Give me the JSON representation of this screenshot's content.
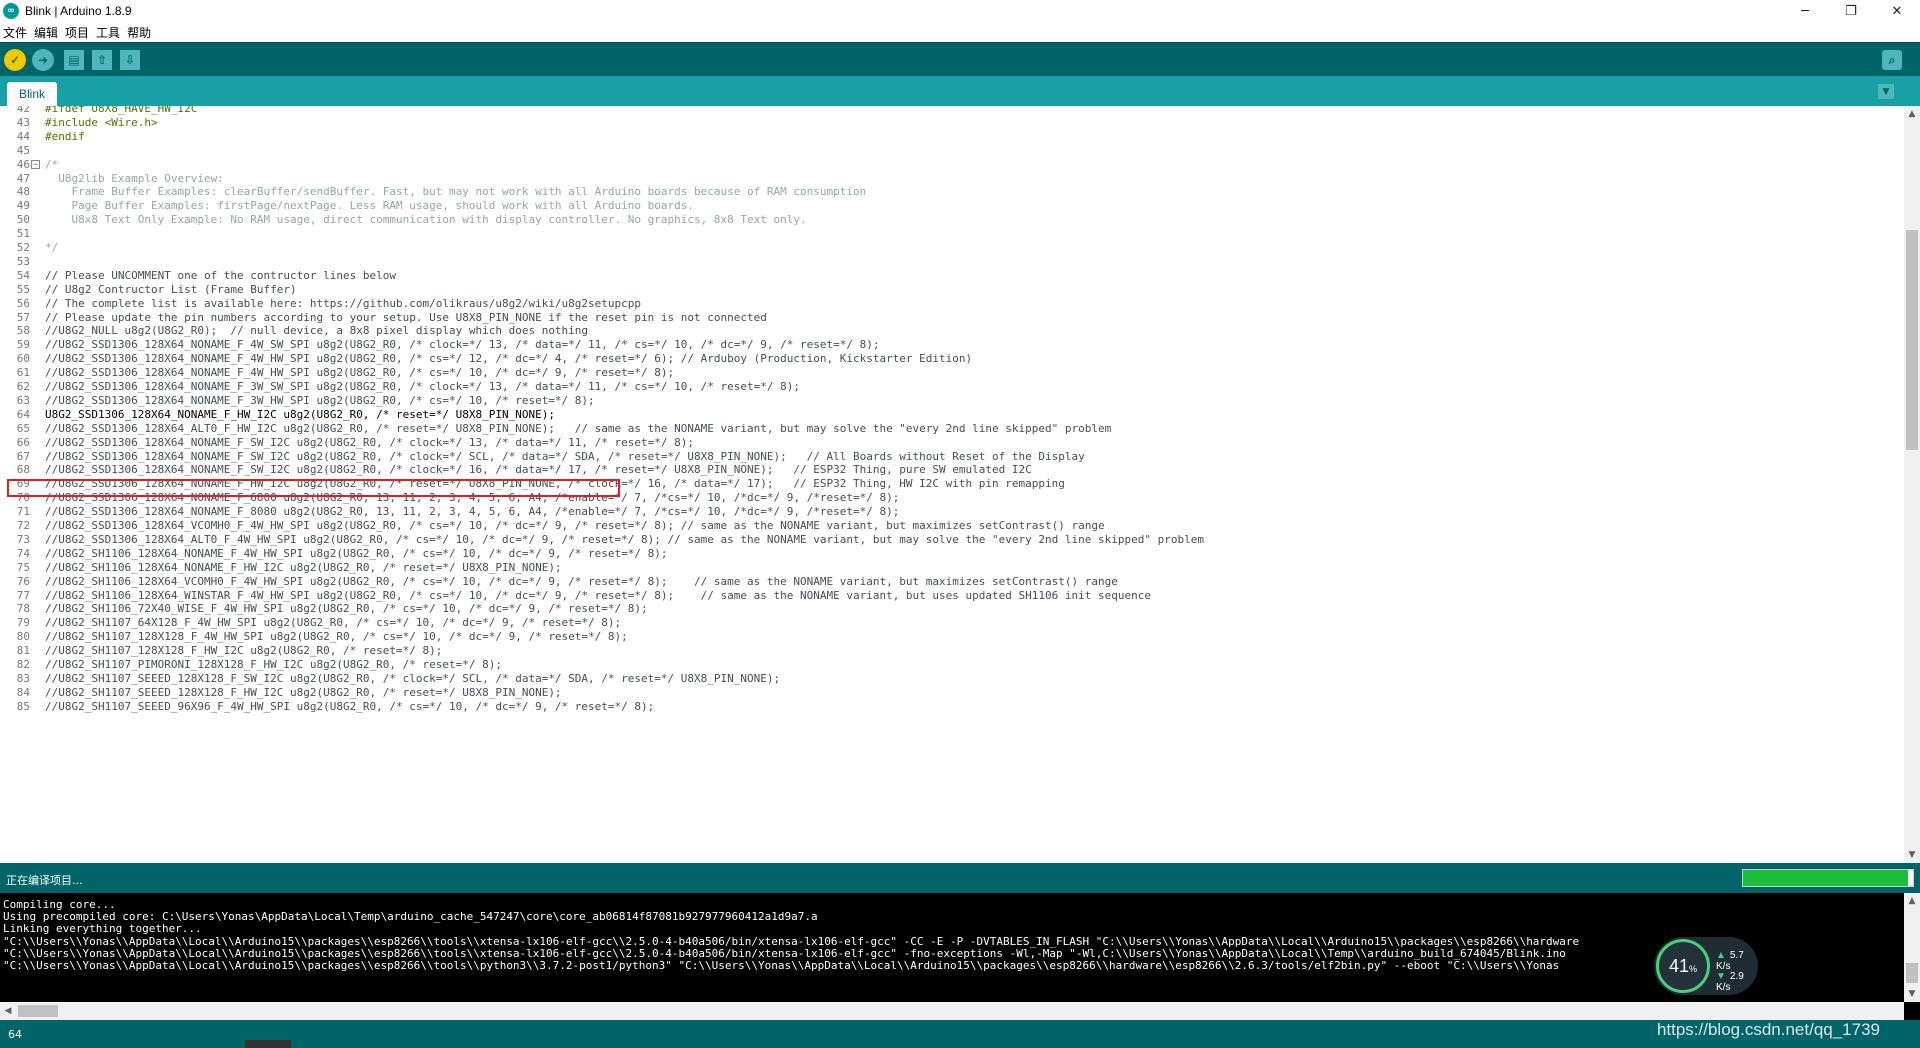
{
  "window": {
    "title": "Blink | Arduino 1.8.9",
    "icon_glyph": "∞",
    "minimize_glyph": "─",
    "maximize_glyph": "❐",
    "close_glyph": "✕"
  },
  "menu": [
    "文件",
    "编辑",
    "项目",
    "工具",
    "帮助"
  ],
  "toolbar": {
    "verify_icon": "check-icon",
    "upload_icon": "arrow-right-icon",
    "new_icon": "new-file-icon",
    "open_icon": "upload-arrow-icon",
    "save_icon": "download-arrow-icon",
    "monitor_icon": "serial-monitor-icon",
    "verify_glyph": "✓",
    "upload_glyph": "➜",
    "new_glyph": "▤",
    "open_glyph": "⇧",
    "save_glyph": "⇩",
    "monitor_glyph": "⌕"
  },
  "tabs": [
    {
      "label": "Blink"
    }
  ],
  "tab_menu_glyph": "▼",
  "editor": {
    "lines": [
      {
        "n": "42",
        "text": "#ifdef U8X8_HAVE_HW_I2C",
        "kind": "dir"
      },
      {
        "n": "43",
        "text": "#include <Wire.h>",
        "kind": "dir"
      },
      {
        "n": "44",
        "text": "#endif",
        "kind": "dir"
      },
      {
        "n": "45",
        "text": "",
        "kind": "code"
      },
      {
        "n": "46",
        "text": "/*",
        "kind": "cmt",
        "fold": true
      },
      {
        "n": "47",
        "text": "  U8g2lib Example Overview:",
        "kind": "cmt"
      },
      {
        "n": "48",
        "text": "    Frame Buffer Examples: clearBuffer/sendBuffer. Fast, but may not work with all Arduino boards because of RAM consumption",
        "kind": "cmt"
      },
      {
        "n": "49",
        "text": "    Page Buffer Examples: firstPage/nextPage. Less RAM usage, should work with all Arduino boards.",
        "kind": "cmt"
      },
      {
        "n": "50",
        "text": "    U8x8 Text Only Example: No RAM usage, direct communication with display controller. No graphics, 8x8 Text only.",
        "kind": "cmt"
      },
      {
        "n": "51",
        "text": "",
        "kind": "cmt"
      },
      {
        "n": "52",
        "text": "*/",
        "kind": "cmt"
      },
      {
        "n": "53",
        "text": "",
        "kind": "code"
      },
      {
        "n": "54",
        "text": "// Please UNCOMMENT one of the contructor lines below",
        "kind": "code"
      },
      {
        "n": "55",
        "text": "// U8g2 Contructor List (Frame Buffer)",
        "kind": "code"
      },
      {
        "n": "56",
        "text": "// The complete list is available here: https://github.com/olikraus/u8g2/wiki/u8g2setupcpp",
        "kind": "code"
      },
      {
        "n": "57",
        "text": "// Please update the pin numbers according to your setup. Use U8X8_PIN_NONE if the reset pin is not connected",
        "kind": "code"
      },
      {
        "n": "58",
        "text": "//U8G2_NULL u8g2(U8G2_R0);  // null device, a 8x8 pixel display which does nothing",
        "kind": "code"
      },
      {
        "n": "59",
        "text": "//U8G2_SSD1306_128X64_NONAME_F_4W_SW_SPI u8g2(U8G2_R0, /* clock=*/ 13, /* data=*/ 11, /* cs=*/ 10, /* dc=*/ 9, /* reset=*/ 8);",
        "kind": "code"
      },
      {
        "n": "60",
        "text": "//U8G2_SSD1306_128X64_NONAME_F_4W_HW_SPI u8g2(U8G2_R0, /* cs=*/ 12, /* dc=*/ 4, /* reset=*/ 6); // Arduboy (Production, Kickstarter Edition)",
        "kind": "code"
      },
      {
        "n": "61",
        "text": "//U8G2_SSD1306_128X64_NONAME_F_4W_HW_SPI u8g2(U8G2_R0, /* cs=*/ 10, /* dc=*/ 9, /* reset=*/ 8);",
        "kind": "code"
      },
      {
        "n": "62",
        "text": "//U8G2_SSD1306_128X64_NONAME_F_3W_SW_SPI u8g2(U8G2_R0, /* clock=*/ 13, /* data=*/ 11, /* cs=*/ 10, /* reset=*/ 8);",
        "kind": "code"
      },
      {
        "n": "63",
        "text": "//U8G2_SSD1306_128X64_NONAME_F_3W_HW_SPI u8g2(U8G2_R0, /* cs=*/ 10, /* reset=*/ 8);",
        "kind": "code"
      },
      {
        "n": "64",
        "text": "U8G2_SSD1306_128X64_NONAME_F_HW_I2C u8g2(U8G2_R0, /* reset=*/ U8X8_PIN_NONE);",
        "kind": "code",
        "highlight": true
      },
      {
        "n": "65",
        "text": "//U8G2_SSD1306_128X64_ALT0_F_HW_I2C u8g2(U8G2_R0, /* reset=*/ U8X8_PIN_NONE);   // same as the NONAME variant, but may solve the \"every 2nd line skipped\" problem",
        "kind": "code"
      },
      {
        "n": "66",
        "text": "//U8G2_SSD1306_128X64_NONAME_F_SW_I2C u8g2(U8G2_R0, /* clock=*/ 13, /* data=*/ 11, /* reset=*/ 8);",
        "kind": "code"
      },
      {
        "n": "67",
        "text": "//U8G2_SSD1306_128X64_NONAME_F_SW_I2C u8g2(U8G2_R0, /* clock=*/ SCL, /* data=*/ SDA, /* reset=*/ U8X8_PIN_NONE);   // All Boards without Reset of the Display",
        "kind": "code"
      },
      {
        "n": "68",
        "text": "//U8G2_SSD1306_128X64_NONAME_F_SW_I2C u8g2(U8G2_R0, /* clock=*/ 16, /* data=*/ 17, /* reset=*/ U8X8_PIN_NONE);   // ESP32 Thing, pure SW emulated I2C",
        "kind": "code"
      },
      {
        "n": "69",
        "text": "//U8G2_SSD1306_128X64_NONAME_F_HW_I2C u8g2(U8G2_R0, /* reset=*/ U8X8_PIN_NONE, /* clock=*/ 16, /* data=*/ 17);   // ESP32 Thing, HW I2C with pin remapping",
        "kind": "code"
      },
      {
        "n": "70",
        "text": "//U8G2_SSD1306_128X64_NONAME_F_6800 u8g2(U8G2_R0, 13, 11, 2, 3, 4, 5, 6, A4, /*enable=*/ 7, /*cs=*/ 10, /*dc=*/ 9, /*reset=*/ 8);",
        "kind": "code"
      },
      {
        "n": "71",
        "text": "//U8G2_SSD1306_128X64_NONAME_F_8080 u8g2(U8G2_R0, 13, 11, 2, 3, 4, 5, 6, A4, /*enable=*/ 7, /*cs=*/ 10, /*dc=*/ 9, /*reset=*/ 8);",
        "kind": "code"
      },
      {
        "n": "72",
        "text": "//U8G2_SSD1306_128X64_VCOMH0_F_4W_HW_SPI u8g2(U8G2_R0, /* cs=*/ 10, /* dc=*/ 9, /* reset=*/ 8); // same as the NONAME variant, but maximizes setContrast() range",
        "kind": "code"
      },
      {
        "n": "73",
        "text": "//U8G2_SSD1306_128X64_ALT0_F_4W_HW_SPI u8g2(U8G2_R0, /* cs=*/ 10, /* dc=*/ 9, /* reset=*/ 8); // same as the NONAME variant, but may solve the \"every 2nd line skipped\" problem",
        "kind": "code"
      },
      {
        "n": "74",
        "text": "//U8G2_SH1106_128X64_NONAME_F_4W_HW_SPI u8g2(U8G2_R0, /* cs=*/ 10, /* dc=*/ 9, /* reset=*/ 8);",
        "kind": "code"
      },
      {
        "n": "75",
        "text": "//U8G2_SH1106_128X64_NONAME_F_HW_I2C u8g2(U8G2_R0, /* reset=*/ U8X8_PIN_NONE);",
        "kind": "code"
      },
      {
        "n": "76",
        "text": "//U8G2_SH1106_128X64_VCOMH0_F_4W_HW_SPI u8g2(U8G2_R0, /* cs=*/ 10, /* dc=*/ 9, /* reset=*/ 8);    // same as the NONAME variant, but maximizes setContrast() range",
        "kind": "code"
      },
      {
        "n": "77",
        "text": "//U8G2_SH1106_128X64_WINSTAR_F_4W_HW_SPI u8g2(U8G2_R0, /* cs=*/ 10, /* dc=*/ 9, /* reset=*/ 8);    // same as the NONAME variant, but uses updated SH1106 init sequence",
        "kind": "code"
      },
      {
        "n": "78",
        "text": "//U8G2_SH1106_72X40_WISE_F_4W_HW_SPI u8g2(U8G2_R0, /* cs=*/ 10, /* dc=*/ 9, /* reset=*/ 8);",
        "kind": "code"
      },
      {
        "n": "79",
        "text": "//U8G2_SH1107_64X128_F_4W_HW_SPI u8g2(U8G2_R0, /* cs=*/ 10, /* dc=*/ 9, /* reset=*/ 8);",
        "kind": "code"
      },
      {
        "n": "80",
        "text": "//U8G2_SH1107_128X128_F_4W_HW_SPI u8g2(U8G2_R0, /* cs=*/ 10, /* dc=*/ 9, /* reset=*/ 8);",
        "kind": "code"
      },
      {
        "n": "81",
        "text": "//U8G2_SH1107_128X128_F_HW_I2C u8g2(U8G2_R0, /* reset=*/ 8);",
        "kind": "code"
      },
      {
        "n": "82",
        "text": "//U8G2_SH1107_PIMORONI_128X128_F_HW_I2C u8g2(U8G2_R0, /* reset=*/ 8);",
        "kind": "code"
      },
      {
        "n": "83",
        "text": "//U8G2_SH1107_SEEED_128X128_F_SW_I2C u8g2(U8G2_R0, /* clock=*/ SCL, /* data=*/ SDA, /* reset=*/ U8X8_PIN_NONE);",
        "kind": "code"
      },
      {
        "n": "84",
        "text": "//U8G2_SH1107_SEEED_128X128_F_HW_I2C u8g2(U8G2_R0, /* reset=*/ U8X8_PIN_NONE);",
        "kind": "code"
      },
      {
        "n": "85",
        "text": "//U8G2_SH1107_SEEED_96X96_F_4W_HW_SPI u8g2(U8G2_R0, /* cs=*/ 10, /* dc=*/ 9, /* reset=*/ 8);",
        "kind": "code"
      }
    ]
  },
  "status": {
    "message": "正在编译项目...",
    "progress_fraction": 0.97
  },
  "console": {
    "lines": [
      "Compiling core...",
      "Using precompiled core: C:\\Users\\Yonas\\AppData\\Local\\Temp\\arduino_cache_547247\\core\\core_ab06814f87081b927977960412a1d9a7.a",
      "Linking everything together...",
      "\"C:\\\\Users\\\\Yonas\\\\AppData\\\\Local\\\\Arduino15\\\\packages\\\\esp8266\\\\tools\\\\xtensa-lx106-elf-gcc\\\\2.5.0-4-b40a506/bin/xtensa-lx106-elf-gcc\" -CC -E -P -DVTABLES_IN_FLASH \"C:\\\\Users\\\\Yonas\\\\AppData\\\\Local\\\\Arduino15\\\\packages\\\\esp8266\\\\hardware",
      "\"C:\\\\Users\\\\Yonas\\\\AppData\\\\Local\\\\Arduino15\\\\packages\\\\esp8266\\\\tools\\\\xtensa-lx106-elf-gcc\\\\2.5.0-4-b40a506/bin/xtensa-lx106-elf-gcc\" -fno-exceptions -Wl,-Map \"-Wl,C:\\\\Users\\\\Yonas\\\\AppData\\\\Local\\\\Temp\\\\arduino_build_674045/Blink.ino",
      "\"C:\\\\Users\\\\Yonas\\\\AppData\\\\Local\\\\Arduino15\\\\packages\\\\esp8266\\\\tools\\\\python3\\\\3.7.2-post1/python3\" \"C:\\\\Users\\\\Yonas\\\\AppData\\\\Local\\\\Arduino15\\\\packages\\\\esp8266\\\\hardware\\\\esp8266\\\\2.6.3/tools/elf2bin.py\" --eboot \"C:\\\\Users\\\\Yonas"
    ]
  },
  "footer": {
    "line_number": "64",
    "watermark": "https://blog.csdn.net/qq_1739"
  },
  "net_widget": {
    "percent": "41",
    "percent_sign": "%",
    "up_speed": "5.7",
    "up_unit": "K/s",
    "down_speed": "2.9",
    "down_unit": "K/s"
  },
  "colors": {
    "toolbar": "#006468",
    "tabstrip": "#17a1a5",
    "highlight_border": "#e02020",
    "progress_fill": "#1fbd3c"
  }
}
